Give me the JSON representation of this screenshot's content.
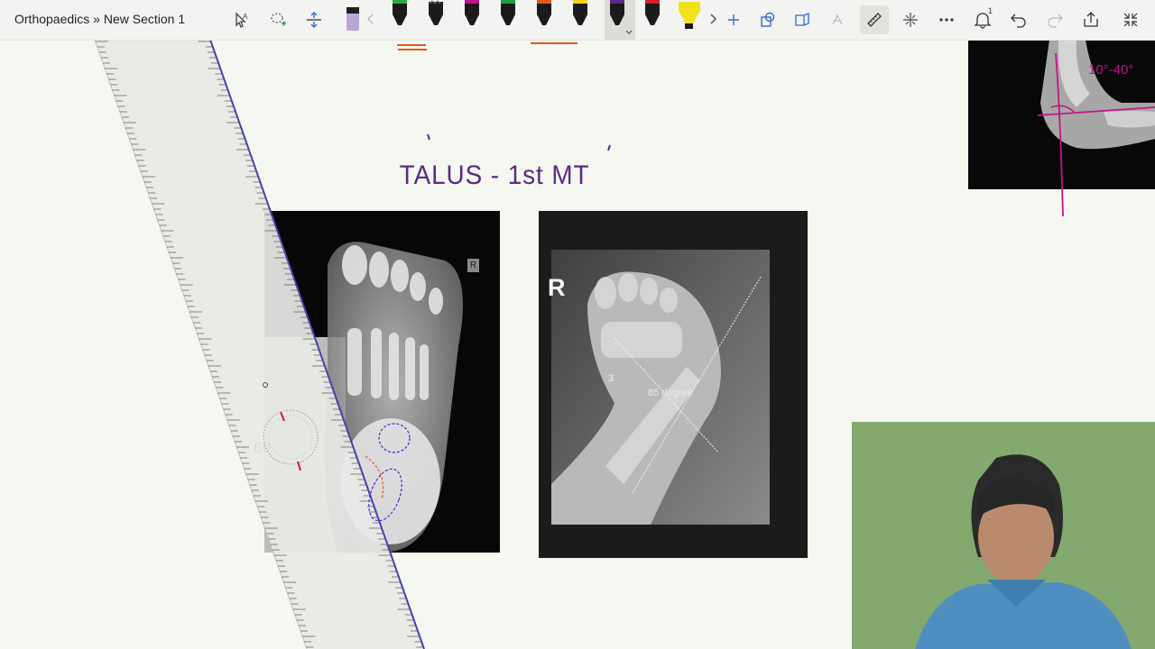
{
  "toolbar": {
    "breadcrumb": "Orthopaedics » New Section 1",
    "notification_count": "1"
  },
  "colors": {
    "ink_purple": "#5b2a86",
    "ink_magenta": "#c0158a",
    "ink_orange": "#e35a1c",
    "ruler_fill": "#e8eae6",
    "canvas_bg": "#f5f8f0",
    "video_bg": "#7ea56a"
  },
  "canvas": {
    "heading": "TALUS - 1st MT",
    "left_xray": {
      "marker": "R"
    },
    "right_xray": {
      "marker": "R",
      "angle_label": "85 degree",
      "small_label": "3"
    },
    "top_xray_note": "10°-40°"
  },
  "ruler": {
    "angle": "69",
    "degree_symbol": "°"
  },
  "icons": {
    "lasso": "lasso-icon",
    "add_space": "add-space-icon",
    "eraser": "eraser-icon",
    "undo": "undo-icon",
    "redo": "redo-icon",
    "share": "share-icon",
    "ruler": "ruler-icon",
    "notifications": "bell-icon"
  }
}
